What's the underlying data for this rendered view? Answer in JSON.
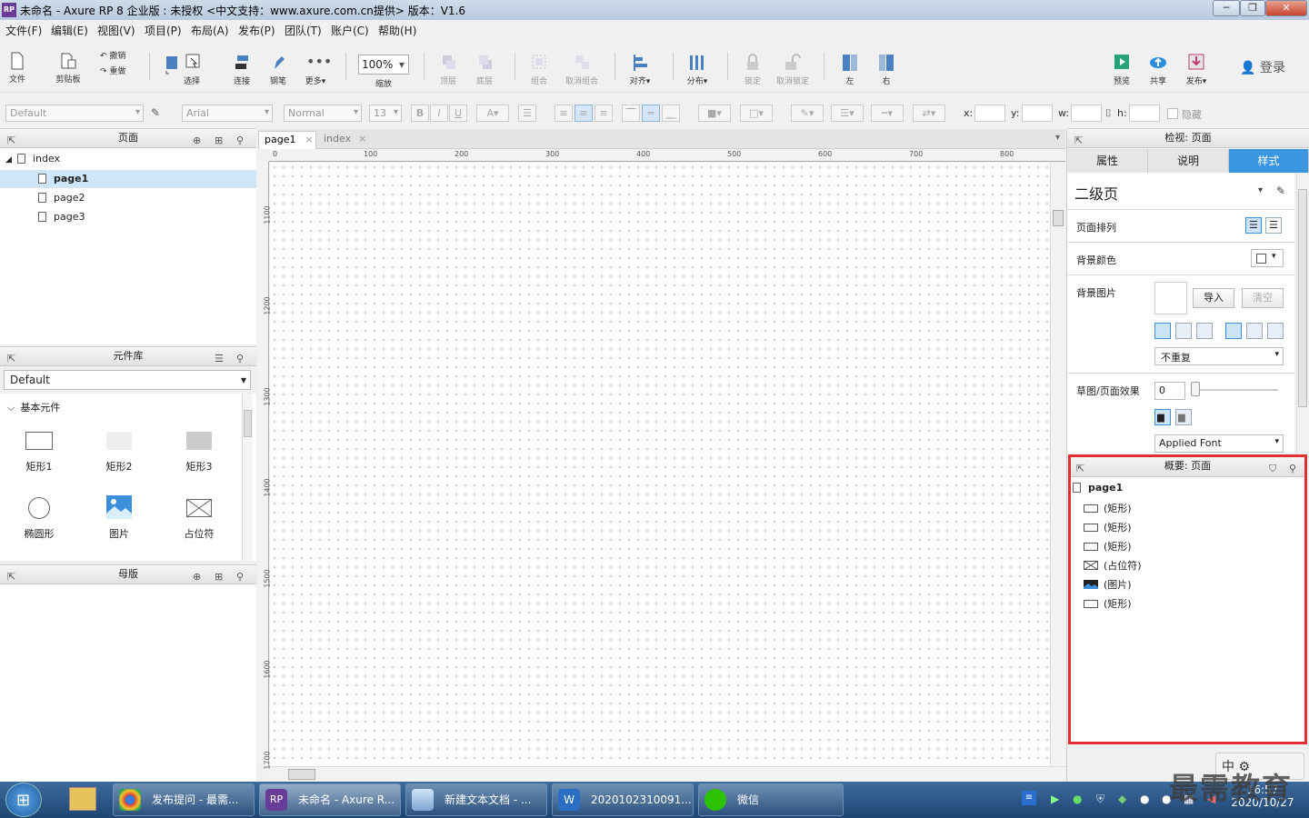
{
  "window": {
    "app_icon": "RP",
    "title": "未命名 - Axure RP 8 企业版 : 未授权      <中文支持：www.axure.com.cn提供> 版本：V1.6",
    "buttons": [
      "─",
      "❐",
      "✕"
    ]
  },
  "menu": [
    "文件(F)",
    "编辑(E)",
    "视图(V)",
    "项目(P)",
    "布局(A)",
    "发布(P)",
    "团队(T)",
    "账户(C)",
    "帮助(H)"
  ],
  "toolbar": {
    "file": "文件",
    "clipboard": "剪贴板",
    "undo": "撤销",
    "redo": "重做",
    "select": "选择",
    "connect": "连接",
    "pen": "钢笔",
    "more": "更多▾",
    "zoom_value": "100%",
    "zoom": "缩放",
    "top": "顶层",
    "bottom": "底层",
    "group": "组合",
    "ungroup": "取消组合",
    "align": "对齐▾",
    "distribute": "分布▾",
    "lock": "锁定",
    "unlock": "取消锁定",
    "left": "左",
    "right": "右",
    "preview": "预览",
    "share": "共享",
    "publish": "发布▾",
    "login": "登录"
  },
  "format": {
    "style": "Default",
    "font": "Arial",
    "weight": "Normal",
    "size": "13",
    "x": "x:",
    "y": "y:",
    "w": "w:",
    "h": "h:",
    "hidden": "隐藏"
  },
  "pages_panel": {
    "title": "页面",
    "root": "index",
    "pages": [
      "page1",
      "page2",
      "page3"
    ]
  },
  "library_panel": {
    "title": "元件库",
    "selected": "Default",
    "group": "基本元件",
    "widgets": [
      "矩形1",
      "矩形2",
      "矩形3",
      "椭圆形",
      "图片",
      "占位符"
    ]
  },
  "masters_panel": {
    "title": "母版"
  },
  "canvas": {
    "tabs": [
      "page1",
      "index"
    ],
    "ruler_h": [
      "0",
      "100",
      "200",
      "300",
      "400",
      "500",
      "600",
      "700",
      "800"
    ],
    "ruler_v": [
      "1100",
      "1200",
      "1300",
      "1400",
      "1500",
      "1600",
      "1700"
    ]
  },
  "inspector": {
    "title": "检视: 页面",
    "tabs": [
      "属性",
      "说明",
      "样式"
    ],
    "active_tab": "样式",
    "style_name": "二级页",
    "page_align": "页面排列",
    "bg_color": "背景颜色",
    "bg_image": "背景图片",
    "import": "导入",
    "clear": "清空",
    "repeat": "不重复",
    "sketch": "草图/页面效果",
    "sketch_value": "0",
    "applied_font": "Applied Font"
  },
  "outline": {
    "title": "概要: 页面",
    "root": "page1",
    "items": [
      "(矩形)",
      "(矩形)",
      "(矩形)",
      "(占位符)",
      "(图片)",
      "(矩形)"
    ],
    "highlight_color": "#e03030"
  },
  "taskbar": {
    "tasks": [
      "发布提问 - 最需...",
      "未命名 - Axure R...",
      "新建文本文档 - ...",
      "2020102310091...",
      "微信"
    ],
    "time": "16:57",
    "date": "2020/10/27",
    "watermark": "最需教育",
    "ime": "中"
  }
}
